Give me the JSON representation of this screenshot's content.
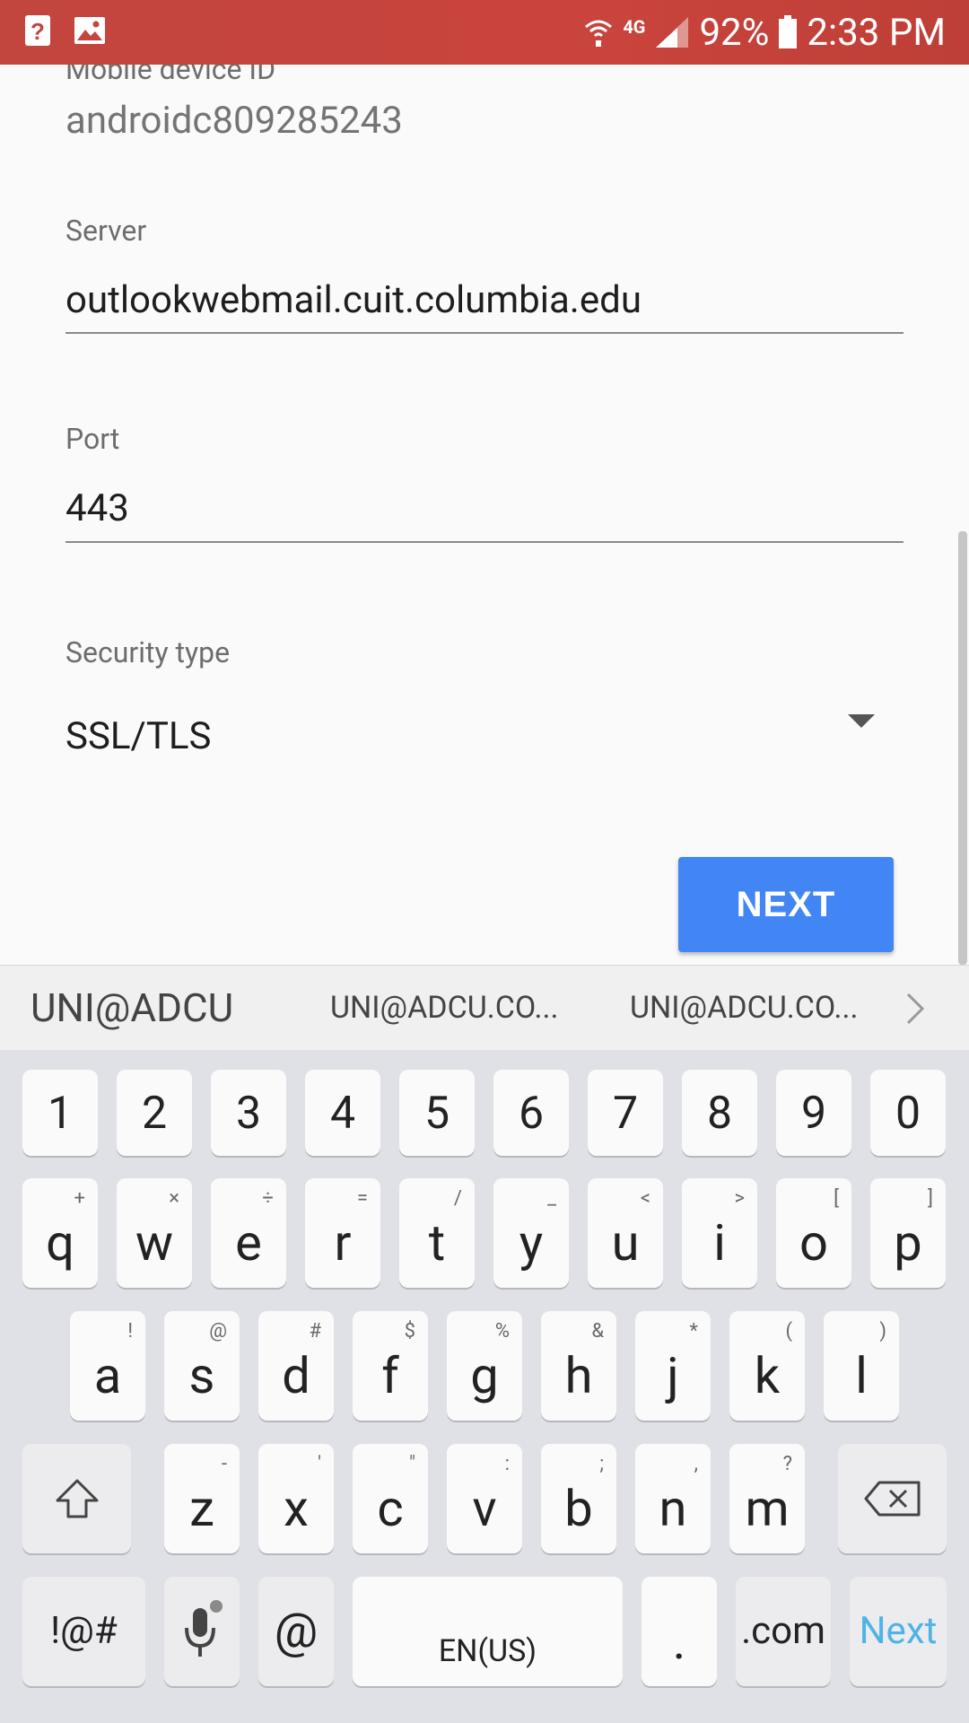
{
  "status_bar": {
    "left_icons": [
      "help-notification-icon",
      "image-notification-icon"
    ],
    "network": "4G",
    "battery_percent": "92%",
    "time": "2:33 PM"
  },
  "form": {
    "mobile_device_id_label": "Mobile device ID",
    "mobile_device_id_value": "androidc809285243",
    "server_label": "Server",
    "server_value": "outlookwebmail.cuit.columbia.edu",
    "port_label": "Port",
    "port_value": "443",
    "security_type_label": "Security type",
    "security_type_value": "SSL/TLS",
    "next_button": "NEXT"
  },
  "suggestions": [
    "UNI@ADCU",
    "UNI@ADCU.CO...",
    "UNI@ADCU.CO..."
  ],
  "keyboard": {
    "numbers": [
      "1",
      "2",
      "3",
      "4",
      "5",
      "6",
      "7",
      "8",
      "9",
      "0"
    ],
    "row1": [
      {
        "key": "q",
        "sub": "+"
      },
      {
        "key": "w",
        "sub": "×"
      },
      {
        "key": "e",
        "sub": "÷"
      },
      {
        "key": "r",
        "sub": "="
      },
      {
        "key": "t",
        "sub": "/"
      },
      {
        "key": "y",
        "sub": "_"
      },
      {
        "key": "u",
        "sub": "<"
      },
      {
        "key": "i",
        "sub": ">"
      },
      {
        "key": "o",
        "sub": "["
      },
      {
        "key": "p",
        "sub": "]"
      }
    ],
    "row2": [
      {
        "key": "a",
        "sub": "!"
      },
      {
        "key": "s",
        "sub": "@"
      },
      {
        "key": "d",
        "sub": "#"
      },
      {
        "key": "f",
        "sub": "$"
      },
      {
        "key": "g",
        "sub": "%"
      },
      {
        "key": "h",
        "sub": "&"
      },
      {
        "key": "j",
        "sub": "*"
      },
      {
        "key": "k",
        "sub": "("
      },
      {
        "key": "l",
        "sub": ")"
      }
    ],
    "row3": [
      {
        "key": "z",
        "sub": "-"
      },
      {
        "key": "x",
        "sub": "'"
      },
      {
        "key": "c",
        "sub": "\""
      },
      {
        "key": "v",
        "sub": ":"
      },
      {
        "key": "b",
        "sub": ";"
      },
      {
        "key": "n",
        "sub": ","
      },
      {
        "key": "m",
        "sub": "?"
      }
    ],
    "symbols_key": "!@#",
    "at_key": "@",
    "space_key": "EN(US)",
    "period_key": ".",
    "dotcom_key": ".com",
    "next_key": "Next",
    "next_key_color": "#4fb3e8"
  }
}
